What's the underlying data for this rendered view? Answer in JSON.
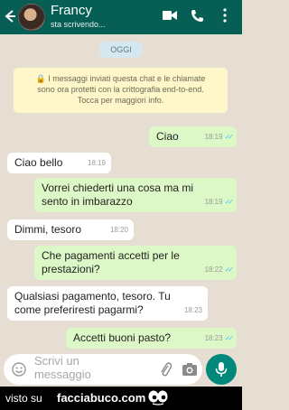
{
  "header": {
    "contact_name": "Francy",
    "status": "sta scrivendo...",
    "icons": [
      "arrow-back-icon",
      "avatar",
      "video-call-icon",
      "phone-icon",
      "more-vert-icon"
    ],
    "color": "#075e54"
  },
  "chat": {
    "date": "OGGI",
    "system_notice": {
      "lines": [
        "🔒 I messaggi inviati questa chat e le chiamate",
        "sono ora protetti con la crittografia end-to-end.",
        "Tocca per maggiori info."
      ]
    },
    "messages": [
      {
        "direction": "out",
        "lines": [
          "Ciao"
        ],
        "time": "18:19",
        "ticks": "✓✓"
      },
      {
        "direction": "in",
        "lines": [
          "Ciao bello"
        ],
        "time": "18:19"
      },
      {
        "direction": "out",
        "lines": [
          "Vorrei chiederti una cosa ma mi",
          "sento in imbarazzo"
        ],
        "time": "18:19",
        "ticks": "✓✓"
      },
      {
        "direction": "in",
        "lines": [
          "Dimmi, tesoro"
        ],
        "time": "18:20"
      },
      {
        "direction": "out",
        "lines": [
          "Che pagamenti accetti per le",
          "prestazioni?"
        ],
        "time": "18:22",
        "ticks": "✓✓"
      },
      {
        "direction": "in",
        "lines": [
          "Qualsiasi pagamento, tesoro. Tu",
          "come preferiresti pagarmi?"
        ],
        "time": "18:23"
      },
      {
        "direction": "out",
        "lines": [
          "Accetti buoni pasto?"
        ],
        "time": "18:23",
        "ticks": "✓✓"
      }
    ]
  },
  "input": {
    "placeholder_lines": [
      "Scrivi un",
      "messaggio"
    ],
    "icons": [
      "emoji-icon",
      "attach-icon",
      "camera-icon",
      "mic-icon"
    ]
  },
  "footer": {
    "prefix": "visto su",
    "site": "facciabuco.com"
  }
}
